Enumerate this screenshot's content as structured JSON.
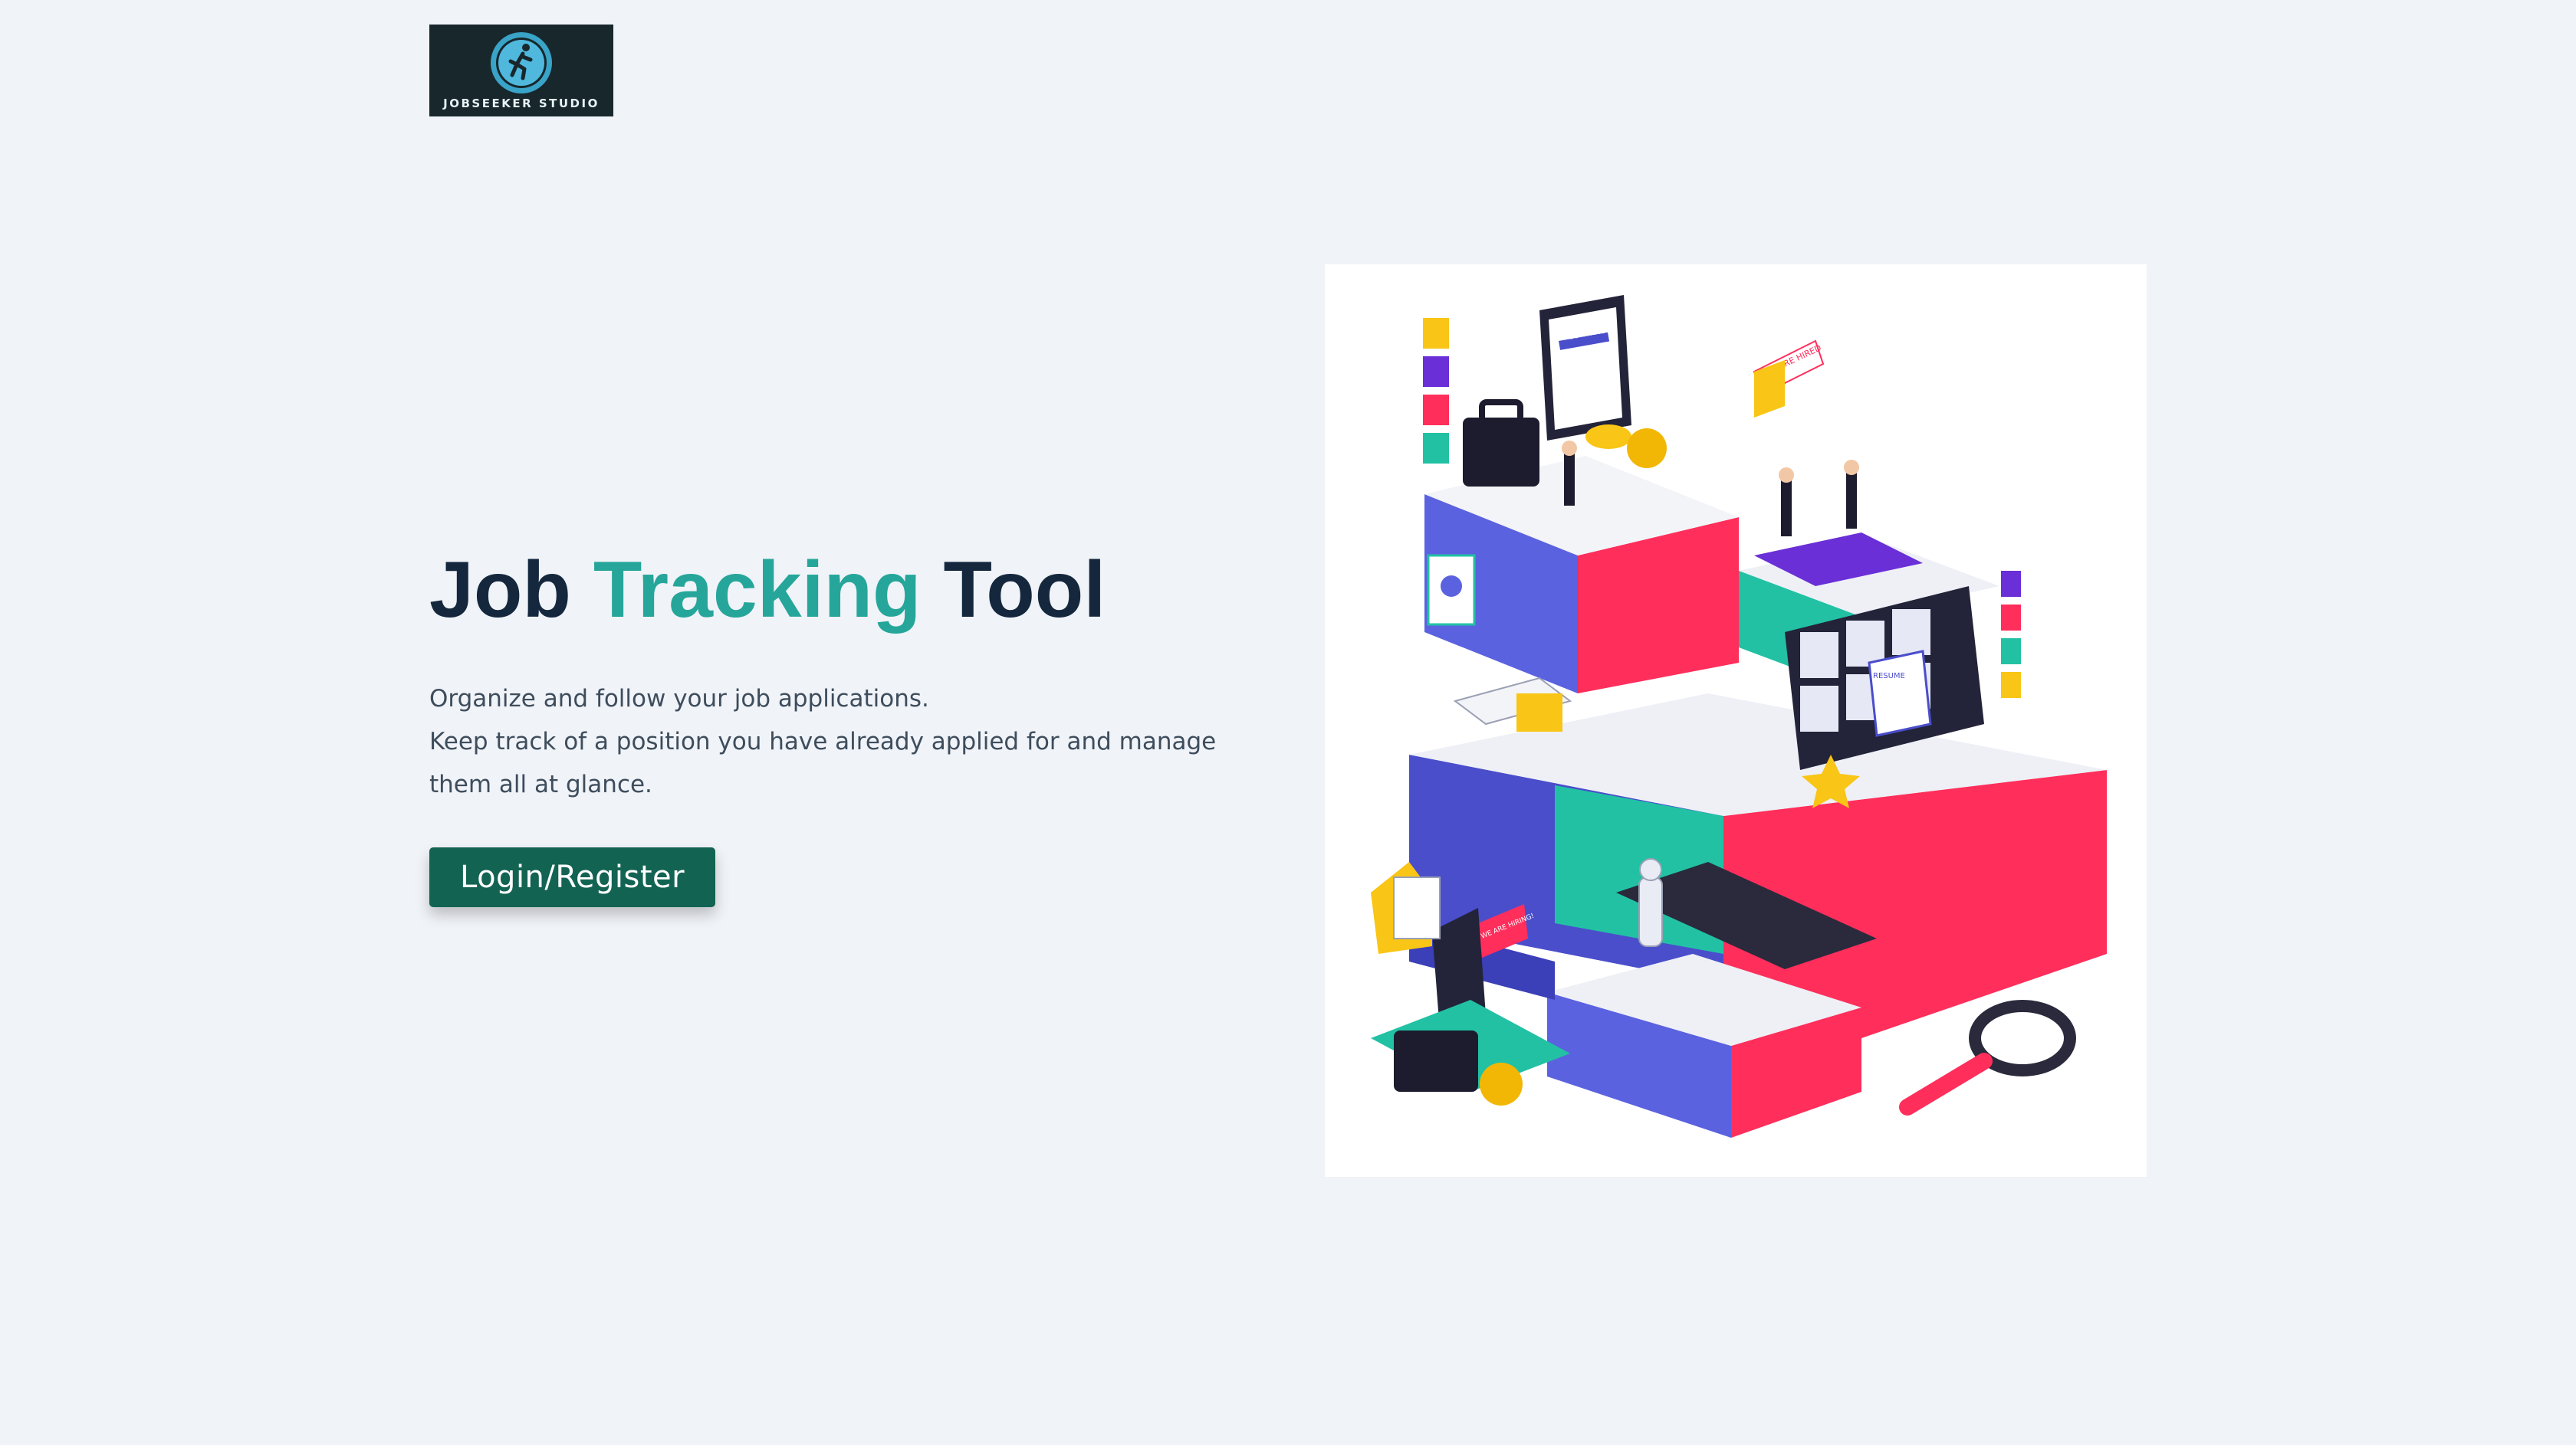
{
  "logo": {
    "text": "JOBSEEKER STUDIO",
    "icon": "runner-emblem-icon",
    "background": "#17272c"
  },
  "hero": {
    "title_part1": "Job",
    "title_part2": "Tracking",
    "title_part3": "Tool",
    "description_line1": "Organize and follow your job applications.",
    "description_line2": "Keep track of a position you have already applied for and manage them all at glance.",
    "button_label": "Login/Register"
  },
  "illustration": {
    "sign_contract": "CONTRACT",
    "sign_hired": "YOU ARE HIRED",
    "sign_resume": "RESUME",
    "sign_hiring": "WE ARE HIRING!"
  },
  "colors": {
    "background": "#f0f3f8",
    "title": "#14273d",
    "accent": "#26a69a",
    "button": "#136353",
    "text": "#3e4d5c"
  }
}
